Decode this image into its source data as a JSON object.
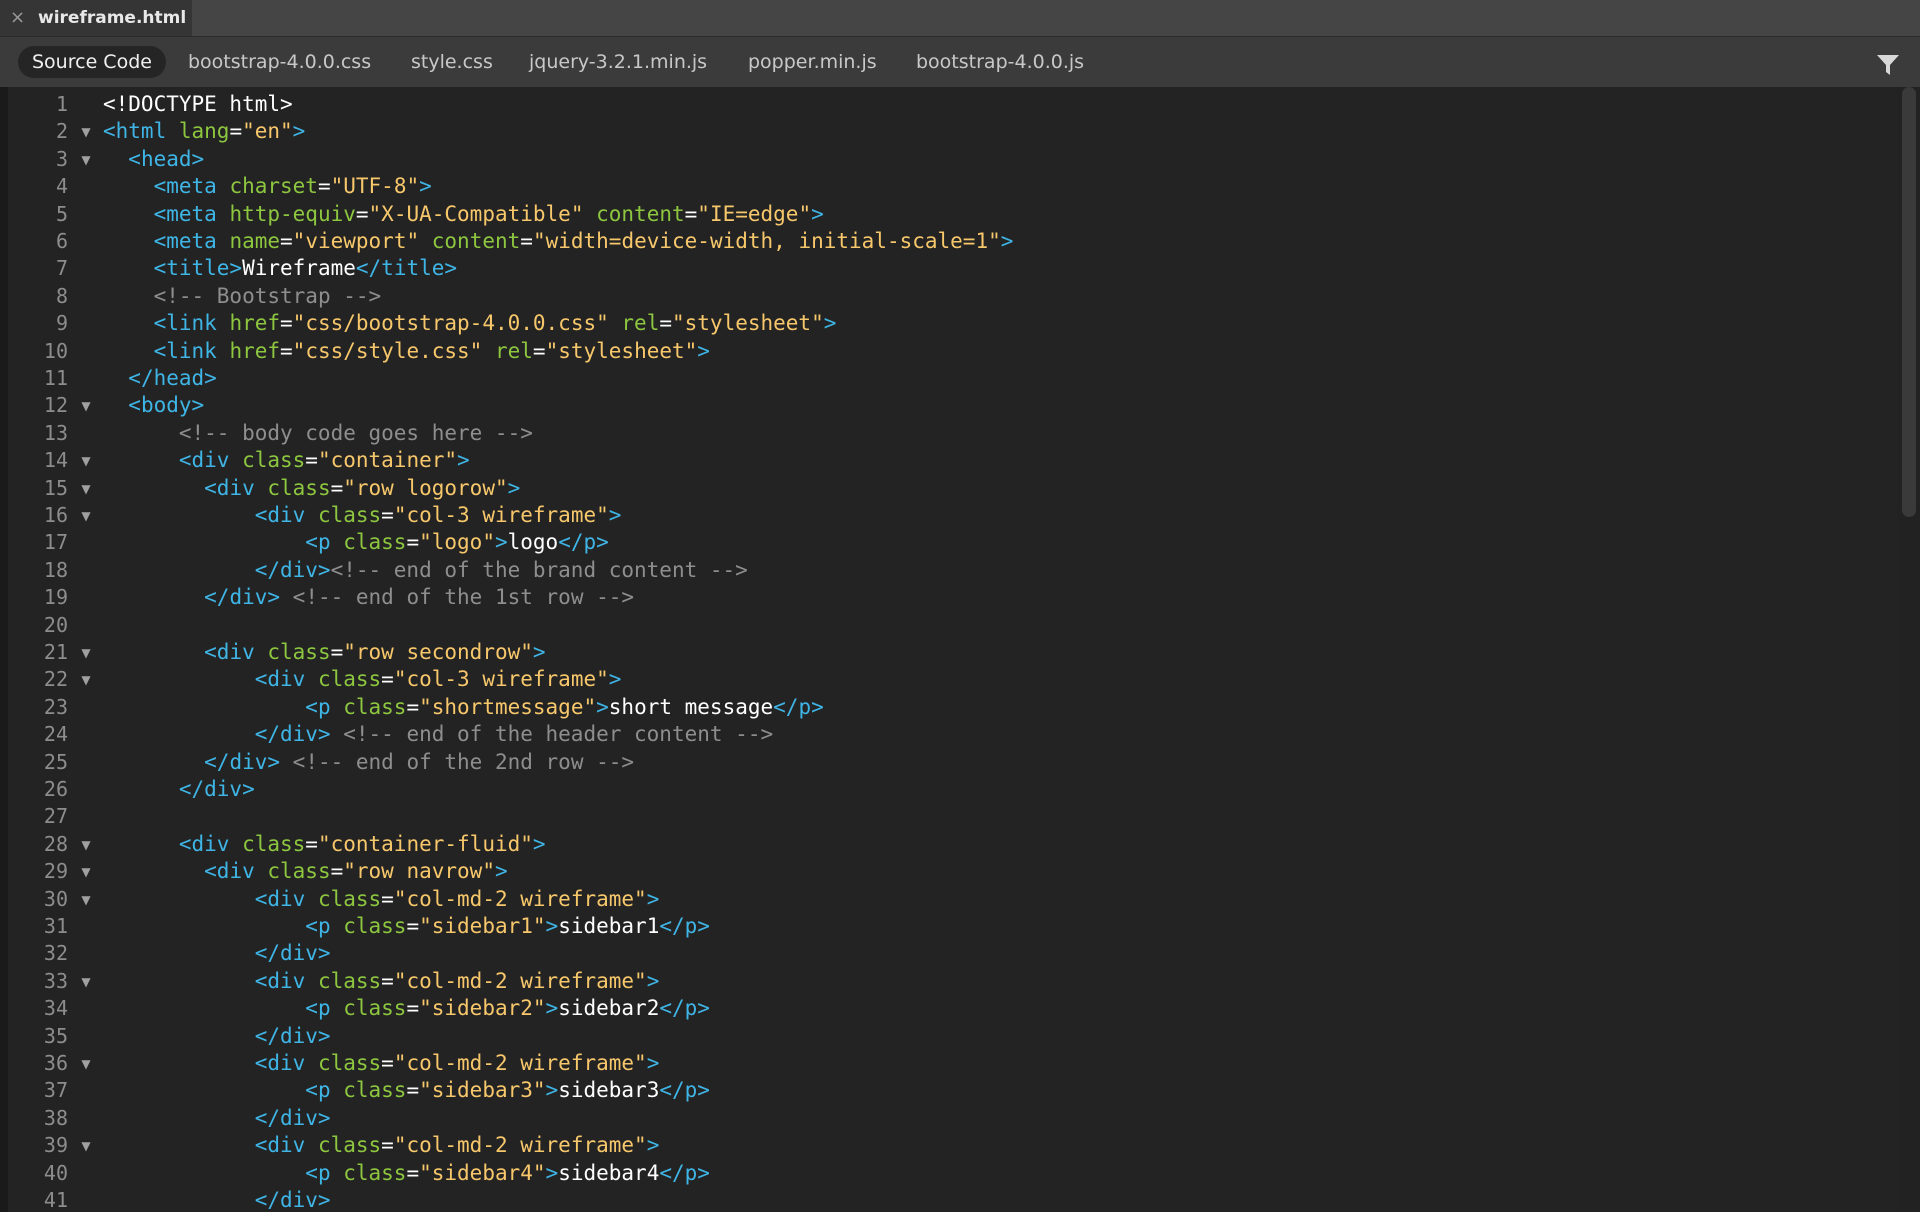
{
  "file_tab": {
    "close_glyph": "×",
    "name": "wireframe.html"
  },
  "related_files": [
    {
      "label": "Source Code",
      "active": true
    },
    {
      "label": "bootstrap-4.0.0.css",
      "active": false
    },
    {
      "label": "style.css",
      "active": false
    },
    {
      "label": "jquery-3.2.1.min.js",
      "active": false
    },
    {
      "label": "popper.min.js",
      "active": false
    },
    {
      "label": "bootstrap-4.0.0.js",
      "active": false
    }
  ],
  "filter_icon": "filter-icon",
  "code_lines": [
    {
      "n": "1",
      "fold": false,
      "tokens": [
        [
          "tag-plain",
          "<!DOCTYPE html>"
        ]
      ]
    },
    {
      "n": "2",
      "fold": true,
      "tokens": [
        [
          "tag",
          "<html "
        ],
        [
          "attr",
          "lang"
        ],
        [
          "eq",
          "="
        ],
        [
          "str",
          "\"en\""
        ],
        [
          "tag",
          ">"
        ]
      ]
    },
    {
      "n": "3",
      "fold": true,
      "tokens": [
        [
          "txt",
          "  "
        ],
        [
          "tag",
          "<head>"
        ]
      ]
    },
    {
      "n": "4",
      "fold": false,
      "tokens": [
        [
          "txt",
          "    "
        ],
        [
          "tag",
          "<meta "
        ],
        [
          "attr",
          "charset"
        ],
        [
          "eq",
          "="
        ],
        [
          "str",
          "\"UTF-8\""
        ],
        [
          "tag",
          ">"
        ]
      ]
    },
    {
      "n": "5",
      "fold": false,
      "tokens": [
        [
          "txt",
          "    "
        ],
        [
          "tag",
          "<meta "
        ],
        [
          "attr",
          "http-equiv"
        ],
        [
          "eq",
          "="
        ],
        [
          "str",
          "\"X-UA-Compatible\""
        ],
        [
          "txt",
          " "
        ],
        [
          "attr",
          "content"
        ],
        [
          "eq",
          "="
        ],
        [
          "str",
          "\"IE=edge\""
        ],
        [
          "tag",
          ">"
        ]
      ]
    },
    {
      "n": "6",
      "fold": false,
      "tokens": [
        [
          "txt",
          "    "
        ],
        [
          "tag",
          "<meta "
        ],
        [
          "attr",
          "name"
        ],
        [
          "eq",
          "="
        ],
        [
          "str",
          "\"viewport\""
        ],
        [
          "txt",
          " "
        ],
        [
          "attr",
          "content"
        ],
        [
          "eq",
          "="
        ],
        [
          "str",
          "\"width=device-width, initial-scale=1\""
        ],
        [
          "tag",
          ">"
        ]
      ]
    },
    {
      "n": "7",
      "fold": false,
      "tokens": [
        [
          "txt",
          "    "
        ],
        [
          "tag",
          "<title>"
        ],
        [
          "txt",
          "Wireframe"
        ],
        [
          "tag",
          "</title>"
        ]
      ]
    },
    {
      "n": "8",
      "fold": false,
      "tokens": [
        [
          "txt",
          "    "
        ],
        [
          "com",
          "<!-- Bootstrap -->"
        ]
      ]
    },
    {
      "n": "9",
      "fold": false,
      "tokens": [
        [
          "txt",
          "    "
        ],
        [
          "tag",
          "<link "
        ],
        [
          "attr",
          "href"
        ],
        [
          "eq",
          "="
        ],
        [
          "str",
          "\"css/bootstrap-4.0.0.css\""
        ],
        [
          "txt",
          " "
        ],
        [
          "attr",
          "rel"
        ],
        [
          "eq",
          "="
        ],
        [
          "str",
          "\"stylesheet\""
        ],
        [
          "tag",
          ">"
        ]
      ]
    },
    {
      "n": "10",
      "fold": false,
      "tokens": [
        [
          "txt",
          "    "
        ],
        [
          "tag",
          "<link "
        ],
        [
          "attr",
          "href"
        ],
        [
          "eq",
          "="
        ],
        [
          "str",
          "\"css/style.css\""
        ],
        [
          "txt",
          " "
        ],
        [
          "attr",
          "rel"
        ],
        [
          "eq",
          "="
        ],
        [
          "str",
          "\"stylesheet\""
        ],
        [
          "tag",
          ">"
        ]
      ]
    },
    {
      "n": "11",
      "fold": false,
      "tokens": [
        [
          "txt",
          "  "
        ],
        [
          "tag",
          "</head>"
        ]
      ]
    },
    {
      "n": "12",
      "fold": true,
      "tokens": [
        [
          "txt",
          "  "
        ],
        [
          "tag",
          "<body>"
        ]
      ]
    },
    {
      "n": "13",
      "fold": false,
      "tokens": [
        [
          "txt",
          "      "
        ],
        [
          "com",
          "<!-- body code goes here -->"
        ]
      ]
    },
    {
      "n": "14",
      "fold": true,
      "tokens": [
        [
          "txt",
          "      "
        ],
        [
          "tag",
          "<div "
        ],
        [
          "attr",
          "class"
        ],
        [
          "eq",
          "="
        ],
        [
          "str",
          "\"container\""
        ],
        [
          "tag",
          ">"
        ]
      ]
    },
    {
      "n": "15",
      "fold": true,
      "tokens": [
        [
          "txt",
          "        "
        ],
        [
          "tag",
          "<div "
        ],
        [
          "attr",
          "class"
        ],
        [
          "eq",
          "="
        ],
        [
          "str",
          "\"row logorow\""
        ],
        [
          "tag",
          ">"
        ]
      ]
    },
    {
      "n": "16",
      "fold": true,
      "tokens": [
        [
          "txt",
          "            "
        ],
        [
          "tag",
          "<div "
        ],
        [
          "attr",
          "class"
        ],
        [
          "eq",
          "="
        ],
        [
          "str",
          "\"col-3 wireframe\""
        ],
        [
          "tag",
          ">"
        ]
      ]
    },
    {
      "n": "17",
      "fold": false,
      "tokens": [
        [
          "txt",
          "                "
        ],
        [
          "tag",
          "<p "
        ],
        [
          "attr",
          "class"
        ],
        [
          "eq",
          "="
        ],
        [
          "str",
          "\"logo\""
        ],
        [
          "tag",
          ">"
        ],
        [
          "txt",
          "logo"
        ],
        [
          "tag",
          "</p>"
        ]
      ]
    },
    {
      "n": "18",
      "fold": false,
      "tokens": [
        [
          "txt",
          "            "
        ],
        [
          "tag",
          "</div>"
        ],
        [
          "com",
          "<!-- end of the brand content -->"
        ]
      ]
    },
    {
      "n": "19",
      "fold": false,
      "tokens": [
        [
          "txt",
          "        "
        ],
        [
          "tag",
          "</div>"
        ],
        [
          "txt",
          " "
        ],
        [
          "com",
          "<!-- end of the 1st row -->"
        ]
      ]
    },
    {
      "n": "20",
      "fold": false,
      "tokens": []
    },
    {
      "n": "21",
      "fold": true,
      "tokens": [
        [
          "txt",
          "        "
        ],
        [
          "tag",
          "<div "
        ],
        [
          "attr",
          "class"
        ],
        [
          "eq",
          "="
        ],
        [
          "str",
          "\"row secondrow\""
        ],
        [
          "tag",
          ">"
        ]
      ]
    },
    {
      "n": "22",
      "fold": true,
      "tokens": [
        [
          "txt",
          "            "
        ],
        [
          "tag",
          "<div "
        ],
        [
          "attr",
          "class"
        ],
        [
          "eq",
          "="
        ],
        [
          "str",
          "\"col-3 wireframe\""
        ],
        [
          "tag",
          ">"
        ]
      ]
    },
    {
      "n": "23",
      "fold": false,
      "tokens": [
        [
          "txt",
          "                "
        ],
        [
          "tag",
          "<p "
        ],
        [
          "attr",
          "class"
        ],
        [
          "eq",
          "="
        ],
        [
          "str",
          "\"shortmessage\""
        ],
        [
          "tag",
          ">"
        ],
        [
          "txt",
          "short message"
        ],
        [
          "tag",
          "</p>"
        ]
      ]
    },
    {
      "n": "24",
      "fold": false,
      "tokens": [
        [
          "txt",
          "            "
        ],
        [
          "tag",
          "</div>"
        ],
        [
          "txt",
          " "
        ],
        [
          "com",
          "<!-- end of the header content -->"
        ]
      ]
    },
    {
      "n": "25",
      "fold": false,
      "tokens": [
        [
          "txt",
          "        "
        ],
        [
          "tag",
          "</div>"
        ],
        [
          "txt",
          " "
        ],
        [
          "com",
          "<!-- end of the 2nd row -->"
        ]
      ]
    },
    {
      "n": "26",
      "fold": false,
      "tokens": [
        [
          "txt",
          "      "
        ],
        [
          "tag",
          "</div>"
        ]
      ]
    },
    {
      "n": "27",
      "fold": false,
      "tokens": []
    },
    {
      "n": "28",
      "fold": true,
      "tokens": [
        [
          "txt",
          "      "
        ],
        [
          "tag",
          "<div "
        ],
        [
          "attr",
          "class"
        ],
        [
          "eq",
          "="
        ],
        [
          "str",
          "\"container-fluid\""
        ],
        [
          "tag",
          ">"
        ]
      ]
    },
    {
      "n": "29",
      "fold": true,
      "tokens": [
        [
          "txt",
          "        "
        ],
        [
          "tag",
          "<div "
        ],
        [
          "attr",
          "class"
        ],
        [
          "eq",
          "="
        ],
        [
          "str",
          "\"row navrow\""
        ],
        [
          "tag",
          ">"
        ]
      ]
    },
    {
      "n": "30",
      "fold": true,
      "tokens": [
        [
          "txt",
          "            "
        ],
        [
          "tag",
          "<div "
        ],
        [
          "attr",
          "class"
        ],
        [
          "eq",
          "="
        ],
        [
          "str",
          "\"col-md-2 wireframe\""
        ],
        [
          "tag",
          ">"
        ]
      ]
    },
    {
      "n": "31",
      "fold": false,
      "tokens": [
        [
          "txt",
          "                "
        ],
        [
          "tag",
          "<p "
        ],
        [
          "attr",
          "class"
        ],
        [
          "eq",
          "="
        ],
        [
          "str",
          "\"sidebar1\""
        ],
        [
          "tag",
          ">"
        ],
        [
          "txt",
          "sidebar1"
        ],
        [
          "tag",
          "</p>"
        ]
      ]
    },
    {
      "n": "32",
      "fold": false,
      "tokens": [
        [
          "txt",
          "            "
        ],
        [
          "tag",
          "</div>"
        ]
      ]
    },
    {
      "n": "33",
      "fold": true,
      "tokens": [
        [
          "txt",
          "            "
        ],
        [
          "tag",
          "<div "
        ],
        [
          "attr",
          "class"
        ],
        [
          "eq",
          "="
        ],
        [
          "str",
          "\"col-md-2 wireframe\""
        ],
        [
          "tag",
          ">"
        ]
      ]
    },
    {
      "n": "34",
      "fold": false,
      "tokens": [
        [
          "txt",
          "                "
        ],
        [
          "tag",
          "<p "
        ],
        [
          "attr",
          "class"
        ],
        [
          "eq",
          "="
        ],
        [
          "str",
          "\"sidebar2\""
        ],
        [
          "tag",
          ">"
        ],
        [
          "txt",
          "sidebar2"
        ],
        [
          "tag",
          "</p>"
        ]
      ]
    },
    {
      "n": "35",
      "fold": false,
      "tokens": [
        [
          "txt",
          "            "
        ],
        [
          "tag",
          "</div>"
        ]
      ]
    },
    {
      "n": "36",
      "fold": true,
      "tokens": [
        [
          "txt",
          "            "
        ],
        [
          "tag",
          "<div "
        ],
        [
          "attr",
          "class"
        ],
        [
          "eq",
          "="
        ],
        [
          "str",
          "\"col-md-2 wireframe\""
        ],
        [
          "tag",
          ">"
        ]
      ]
    },
    {
      "n": "37",
      "fold": false,
      "tokens": [
        [
          "txt",
          "                "
        ],
        [
          "tag",
          "<p "
        ],
        [
          "attr",
          "class"
        ],
        [
          "eq",
          "="
        ],
        [
          "str",
          "\"sidebar3\""
        ],
        [
          "tag",
          ">"
        ],
        [
          "txt",
          "sidebar3"
        ],
        [
          "tag",
          "</p>"
        ]
      ]
    },
    {
      "n": "38",
      "fold": false,
      "tokens": [
        [
          "txt",
          "            "
        ],
        [
          "tag",
          "</div>"
        ]
      ]
    },
    {
      "n": "39",
      "fold": true,
      "tokens": [
        [
          "txt",
          "            "
        ],
        [
          "tag",
          "<div "
        ],
        [
          "attr",
          "class"
        ],
        [
          "eq",
          "="
        ],
        [
          "str",
          "\"col-md-2 wireframe\""
        ],
        [
          "tag",
          ">"
        ]
      ]
    },
    {
      "n": "40",
      "fold": false,
      "tokens": [
        [
          "txt",
          "                "
        ],
        [
          "tag",
          "<p "
        ],
        [
          "attr",
          "class"
        ],
        [
          "eq",
          "="
        ],
        [
          "str",
          "\"sidebar4\""
        ],
        [
          "tag",
          ">"
        ],
        [
          "txt",
          "sidebar4"
        ],
        [
          "tag",
          "</p>"
        ]
      ]
    },
    {
      "n": "41",
      "fold": false,
      "tokens": [
        [
          "txt",
          "            "
        ],
        [
          "tag",
          "</div>"
        ]
      ]
    }
  ]
}
